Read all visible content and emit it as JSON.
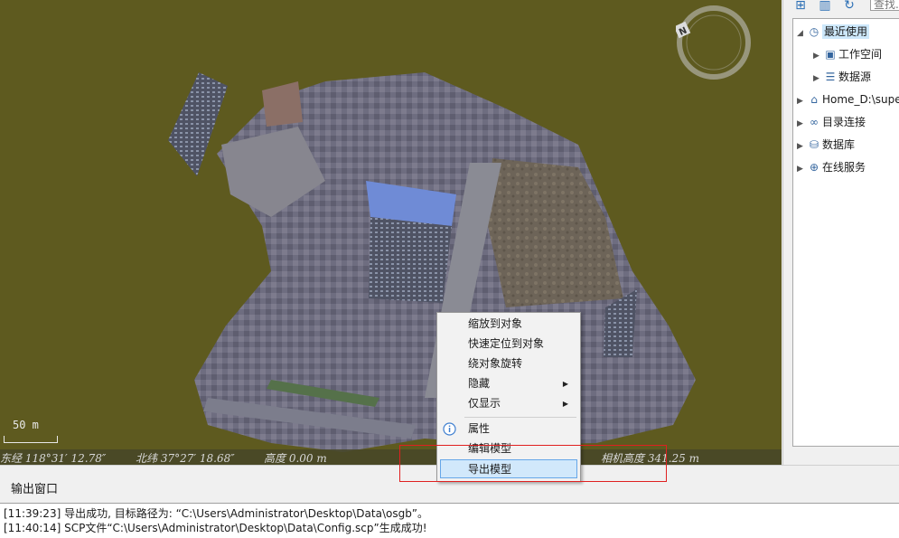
{
  "scene": {
    "background": "#5e5a1f",
    "compass_letter": "N",
    "scale_label": "50 m",
    "status": {
      "longitude": "东经 118°31′ 12.78″",
      "latitude": "北纬 37°27′ 18.68″",
      "altitude": "高度 0.00 m",
      "camera_height": "相机高度 341.25 m"
    }
  },
  "right_panel": {
    "search_placeholder": "查找...",
    "toolbar_icons": [
      "new-icon",
      "library-icon",
      "refresh-icon"
    ],
    "tree": [
      {
        "label": "最近使用",
        "icon": "clock-icon",
        "expanded": true,
        "level": 0,
        "selected": true
      },
      {
        "label": "工作空间",
        "icon": "workspace-icon",
        "expanded": false,
        "level": 1
      },
      {
        "label": "数据源",
        "icon": "datasource-icon",
        "expanded": false,
        "level": 1
      },
      {
        "label": "Home_D:\\super",
        "icon": "home-icon",
        "expanded": false,
        "level": 0
      },
      {
        "label": "目录连接",
        "icon": "link-icon",
        "expanded": false,
        "level": 0
      },
      {
        "label": "数据库",
        "icon": "database-icon",
        "expanded": false,
        "level": 0
      },
      {
        "label": "在线服务",
        "icon": "globe-icon",
        "expanded": false,
        "level": 0
      }
    ]
  },
  "context_menu": {
    "items": [
      {
        "label": "缩放到对象"
      },
      {
        "label": "快速定位到对象"
      },
      {
        "label": "绕对象旋转"
      },
      {
        "label": "隐藏",
        "submenu": true
      },
      {
        "label": "仅显示",
        "submenu": true
      },
      {
        "label": "属性",
        "icon": "info-icon"
      },
      {
        "label": "编辑模型"
      },
      {
        "label": "导出模型",
        "highlighted": true
      }
    ]
  },
  "output": {
    "title": "输出窗口",
    "lines": [
      {
        "time": "[11:39:23]",
        "text": "导出成功, 目标路径为: “C:\\Users\\Administrator\\Desktop\\Data\\osgb”。"
      },
      {
        "time": "[11:40:14]",
        "text": "SCP文件“C:\\Users\\Administrator\\Desktop\\Data\\Config.scp”生成成功!"
      }
    ]
  },
  "colors": {
    "highlight_box": "#e02020",
    "menu_hover": "#d1e8fb",
    "tree_selected": "#cde8fb"
  }
}
